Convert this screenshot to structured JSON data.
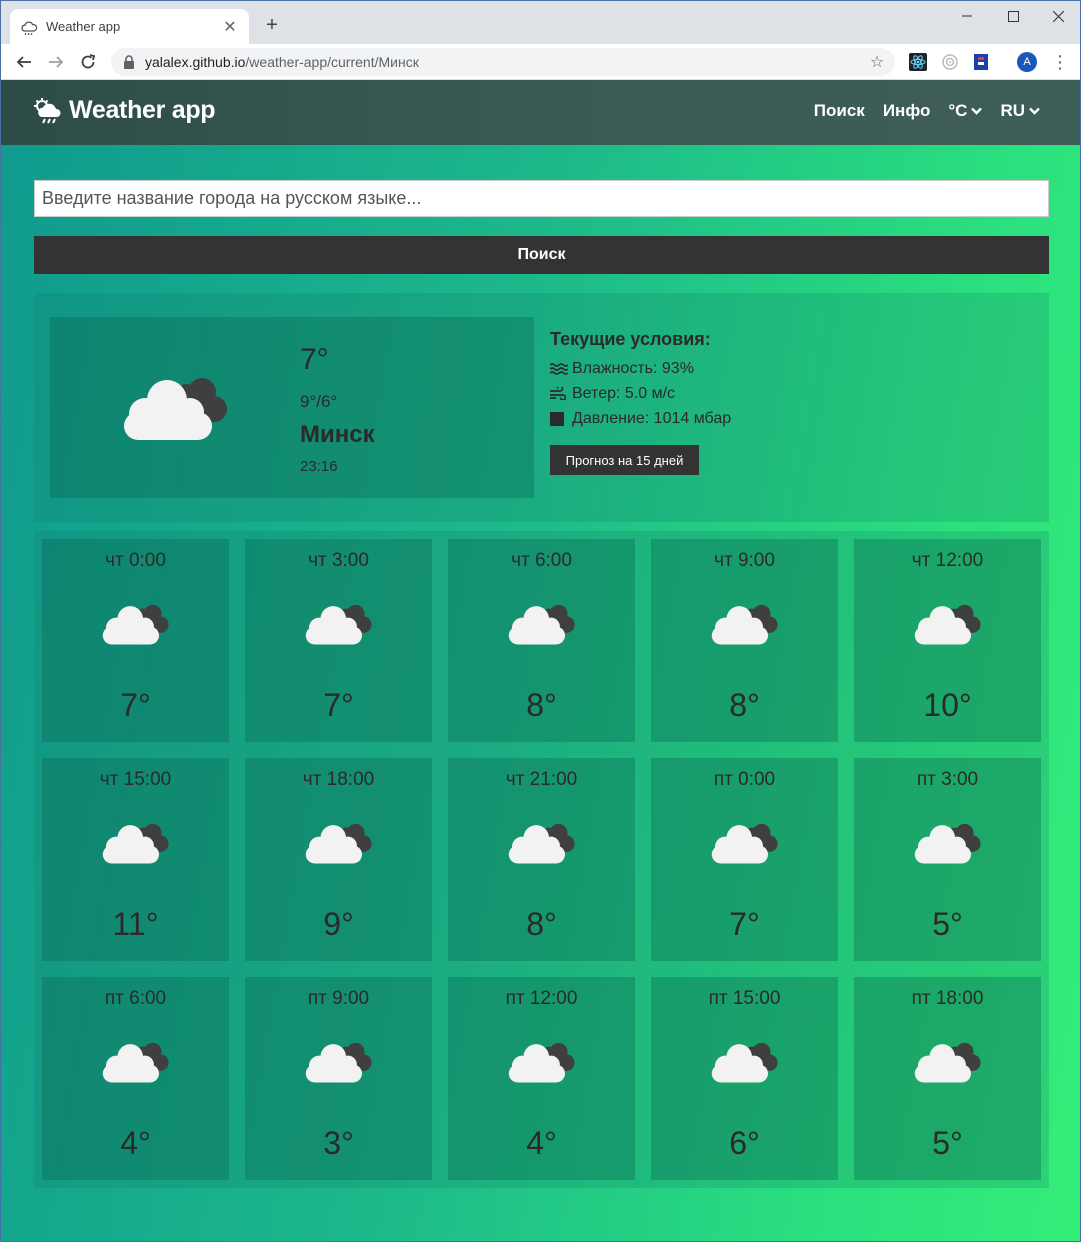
{
  "browser": {
    "tab_title": "Weather app",
    "new_tab": "+",
    "url_host": "yalalex.github.io",
    "url_path": "/weather-app/current/Минск",
    "avatar_letter": "A"
  },
  "app": {
    "brand": "Weather app",
    "nav": {
      "search": "Поиск",
      "info": "Инфо",
      "units": "°C",
      "lang": "RU"
    },
    "search": {
      "placeholder": "Введите название города на русском языке...",
      "button": "Поиск"
    },
    "current": {
      "temp": "7°",
      "range": "9°/6°",
      "city": "Минск",
      "time": "23:16",
      "conditions_title": "Текущие условия:",
      "humidity": "Влажность: 93%",
      "wind": "Ветер: 5.0 м/с",
      "pressure": "Давление: 1014 мбар",
      "forecast_button": "Прогноз на 15 дней",
      "icon": "cloudy-icon"
    },
    "hourly": [
      {
        "time": "чт 0:00",
        "temp": "7°",
        "icon": "cloudy-icon"
      },
      {
        "time": "чт 3:00",
        "temp": "7°",
        "icon": "cloudy-icon"
      },
      {
        "time": "чт 6:00",
        "temp": "8°",
        "icon": "cloudy-icon"
      },
      {
        "time": "чт 9:00",
        "temp": "8°",
        "icon": "cloudy-icon"
      },
      {
        "time": "чт 12:00",
        "temp": "10°",
        "icon": "cloudy-icon"
      },
      {
        "time": "чт 15:00",
        "temp": "11°",
        "icon": "cloudy-icon"
      },
      {
        "time": "чт 18:00",
        "temp": "9°",
        "icon": "cloudy-icon"
      },
      {
        "time": "чт 21:00",
        "temp": "8°",
        "icon": "cloudy-icon"
      },
      {
        "time": "пт 0:00",
        "temp": "7°",
        "icon": "cloudy-icon"
      },
      {
        "time": "пт 3:00",
        "temp": "5°",
        "icon": "cloudy-icon"
      },
      {
        "time": "пт 6:00",
        "temp": "4°",
        "icon": "cloudy-icon"
      },
      {
        "time": "пт 9:00",
        "temp": "3°",
        "icon": "cloudy-icon"
      },
      {
        "time": "пт 12:00",
        "temp": "4°",
        "icon": "cloudy-icon"
      },
      {
        "time": "пт 15:00",
        "temp": "6°",
        "icon": "cloudy-icon"
      },
      {
        "time": "пт 18:00",
        "temp": "5°",
        "icon": "cloudy-icon"
      }
    ]
  },
  "colors": {
    "appbar": "#3c5a55",
    "button": "#333333",
    "gradient_start": "#0f9a8e",
    "gradient_end": "#35ee7a"
  }
}
